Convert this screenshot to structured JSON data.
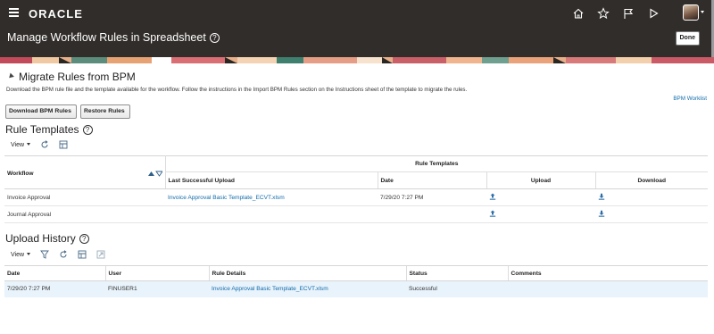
{
  "header": {
    "logo": "ORACLE",
    "page_title": "Manage Workflow Rules in Spreadsheet",
    "help_glyph": "?",
    "done_label": "Done"
  },
  "migrate": {
    "title": "Migrate Rules from BPM",
    "description": "Download the BPM rule file and the template available for the workflow. Follow the instructions in the Import BPM Rules section on the Instructions sheet of the template to migrate the rules.",
    "bpm_worklist_link": "BPM Worklist",
    "download_button": "Download BPM Rules",
    "restore_button": "Restore Rules"
  },
  "rule_templates": {
    "title": "Rule Templates",
    "view_label": "View",
    "group_header": "Rule Templates",
    "columns": {
      "workflow": "Workflow",
      "last_upload": "Last Successful Upload",
      "date": "Date",
      "upload": "Upload",
      "download": "Download"
    },
    "rows": [
      {
        "workflow": "Invoice Approval",
        "last_upload": "Invoice Approval Basic Template_ECVT.xlsm",
        "date": "7/29/20 7:27 PM"
      },
      {
        "workflow": "Journal Approval",
        "last_upload": "",
        "date": ""
      }
    ]
  },
  "upload_history": {
    "title": "Upload History",
    "view_label": "View",
    "columns": {
      "date": "Date",
      "user": "User",
      "rule_details": "Rule Details",
      "status": "Status",
      "comments": "Comments"
    },
    "rows": [
      {
        "date": "7/29/20 7:27 PM",
        "user": "FINUSER1",
        "rule_details": "Invoice Approval Basic Template_ECVT.xlsm",
        "status": "Successful",
        "comments": ""
      }
    ]
  },
  "colors": {
    "header_bg": "#312d2a",
    "link": "#116bab",
    "selected_row": "#e9f3fb"
  },
  "icons": [
    "hamburger-icon",
    "home-icon",
    "star-icon",
    "flag-icon",
    "play-icon",
    "avatar",
    "refresh-icon",
    "detach-icon",
    "freeze-icon",
    "upload-icon",
    "download-icon"
  ]
}
